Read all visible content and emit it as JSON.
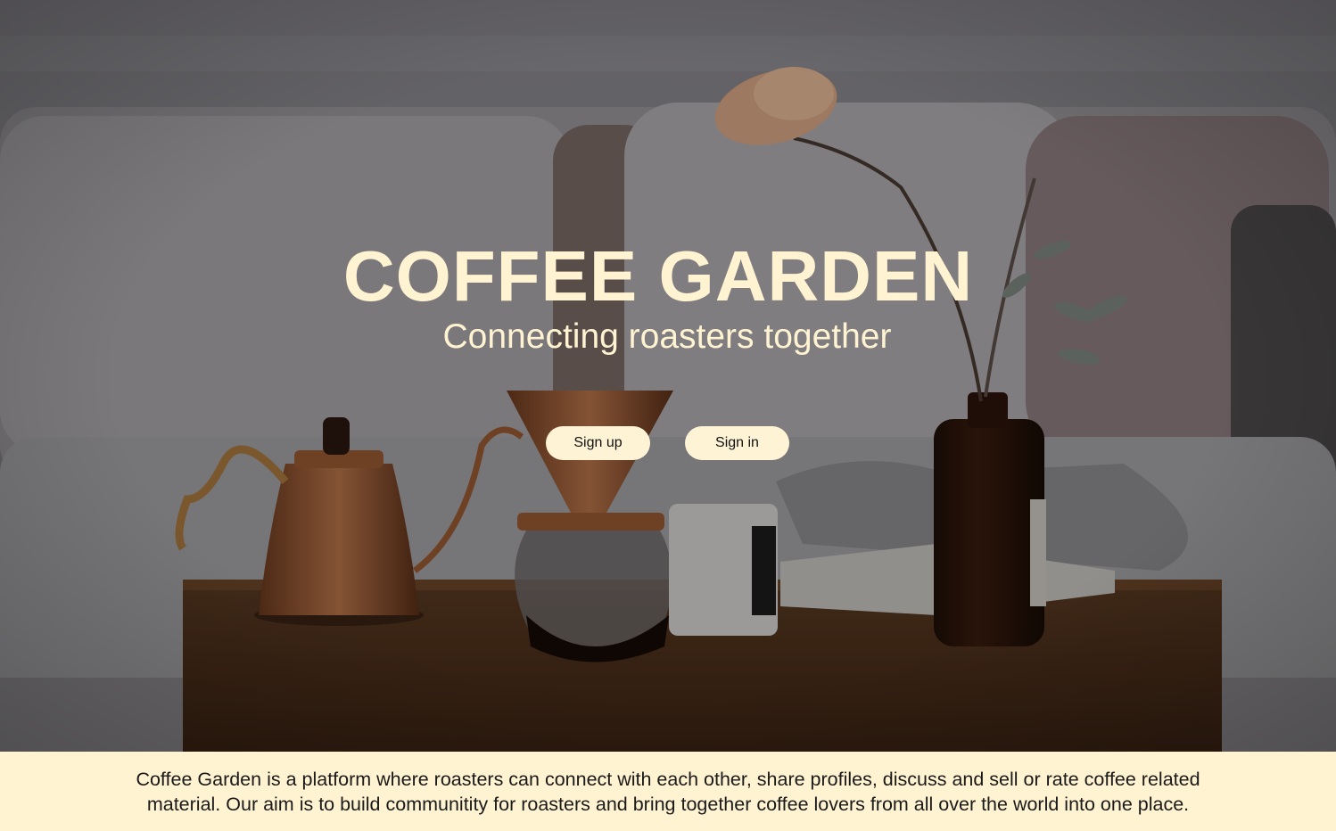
{
  "hero": {
    "title": "COFFEE GARDEN",
    "subtitle": "Connecting roasters together",
    "signup_label": "Sign up",
    "signin_label": "Sign in"
  },
  "about": {
    "text": "Coffee Garden is a platform where roasters can connect with each other, share profiles, discuss and sell or rate coffee related material. Our aim is to build communitity for roasters and bring together coffee lovers from all over the world into one place."
  },
  "colors": {
    "accent_cream": "#fff3d2",
    "button_bg": "#fff3d6",
    "text_dark": "#1a1a1a"
  }
}
